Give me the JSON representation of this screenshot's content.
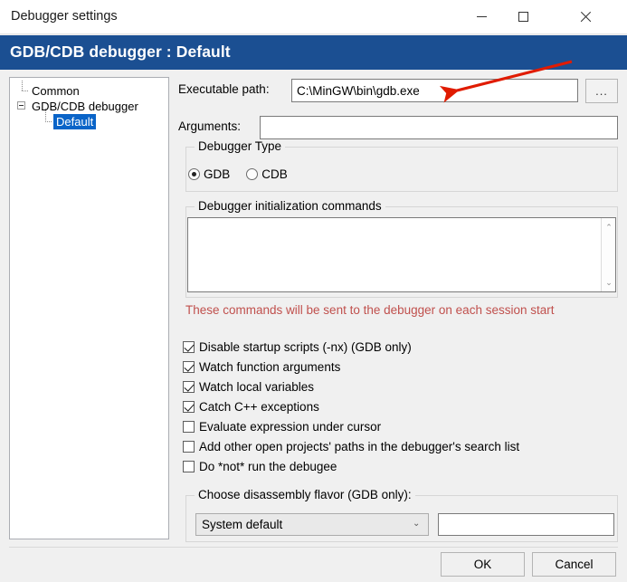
{
  "window": {
    "title": "Debugger settings",
    "controls": {
      "minimize": "minimize",
      "maximize": "maximize",
      "close": "close"
    }
  },
  "banner": {
    "title": "GDB/CDB debugger : Default",
    "color": "#1b4f92"
  },
  "tree": {
    "items": [
      {
        "label": "Common",
        "selected": false
      },
      {
        "label": "GDB/CDB debugger",
        "selected": false
      },
      {
        "label": "Default",
        "selected": true
      }
    ],
    "selection_color": "#0a64c8"
  },
  "fields": {
    "executable_path_label": "Executable path:",
    "executable_path_value": "C:\\MinGW\\bin\\gdb.exe",
    "browse_label": "...",
    "arguments_label": "Arguments:",
    "arguments_value": "",
    "arguments_placeholder": ""
  },
  "debugger_type": {
    "group_title": "Debugger Type",
    "options": [
      {
        "label": "GDB",
        "checked": true
      },
      {
        "label": "CDB",
        "checked": false
      }
    ]
  },
  "init_commands": {
    "group_title": "Debugger initialization commands",
    "value": "",
    "warning": "These commands will be sent to the debugger on each session start",
    "warning_color": "#c0504d",
    "scroll_up": "⌃",
    "scroll_down": "⌄"
  },
  "checkboxes": [
    {
      "label": "Disable startup scripts (-nx) (GDB only)",
      "checked": true
    },
    {
      "label": "Watch function arguments",
      "checked": true
    },
    {
      "label": "Watch local variables",
      "checked": true
    },
    {
      "label": "Catch C++ exceptions",
      "checked": true
    },
    {
      "label": "Evaluate expression under cursor",
      "checked": false
    },
    {
      "label": "Add other open projects' paths in the debugger's search list",
      "checked": false
    },
    {
      "label": "Do *not* run the debugee",
      "checked": false
    }
  ],
  "disassembly": {
    "group_title": "Choose disassembly flavor (GDB only):",
    "selected": "System default",
    "options": [
      "System default"
    ],
    "dropdown_arrow": "⌄",
    "extra_value": ""
  },
  "buttons": {
    "ok": "OK",
    "cancel": "Cancel"
  },
  "annotation": {
    "arrow_color": "#e01b00"
  }
}
